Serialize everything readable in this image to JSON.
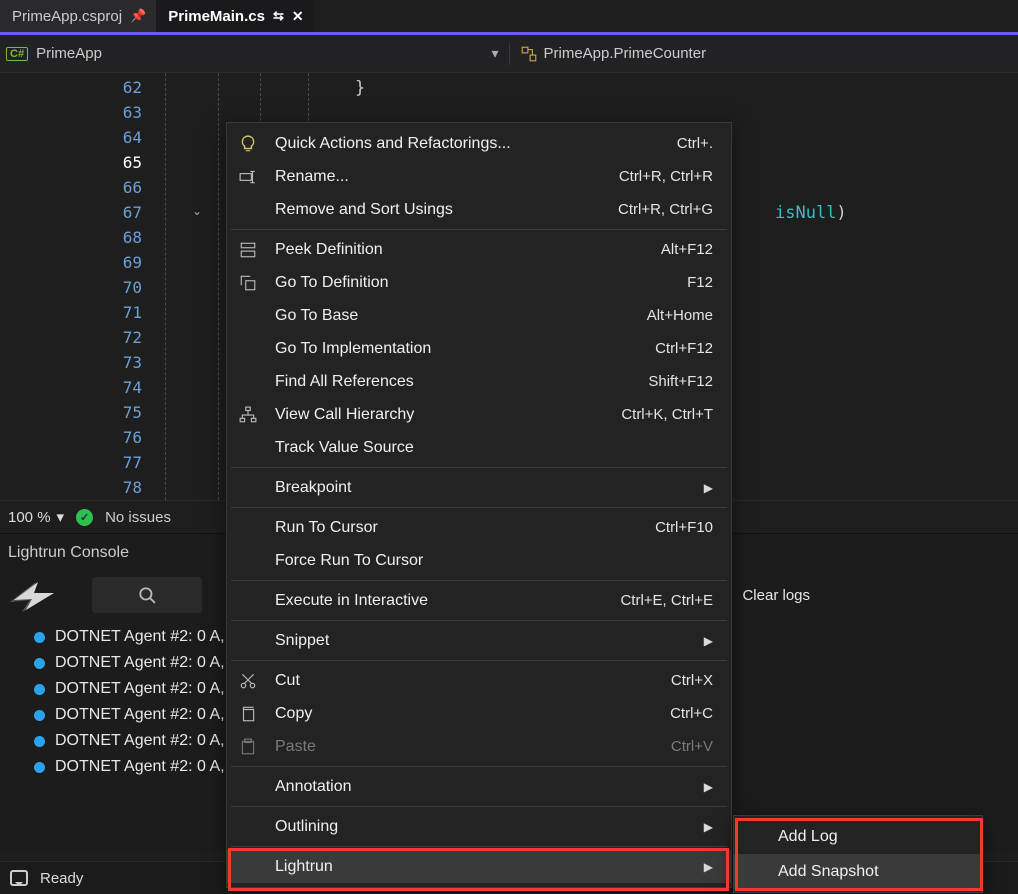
{
  "tabs": [
    {
      "filename": "PrimeApp.csproj",
      "active": false
    },
    {
      "filename": "PrimeMain.cs",
      "active": true
    }
  ],
  "navbar": {
    "left_text": "PrimeApp",
    "right_text": "PrimeApp.PrimeCounter"
  },
  "editor": {
    "line_numbers": [
      "62",
      "63",
      "64",
      "65",
      "66",
      "67",
      "68",
      "69",
      "70",
      "71",
      "72",
      "73",
      "74",
      "75",
      "76",
      "77",
      "78"
    ],
    "current_line": "65",
    "brace": "}",
    "visible_token": "isNull",
    "visible_token_paren": ")"
  },
  "editor_status": {
    "zoom": "100 %",
    "no_issues": "No issues"
  },
  "console": {
    "title": "Lightrun Console",
    "clear_label": "Clear logs",
    "rows": [
      "DOTNET Agent #2: 0",
      "DOTNET Agent #2: 0",
      "DOTNET Agent #2: 0",
      "DOTNET Agent #2: 0",
      "DOTNET Agent #2: 0",
      "DOTNET Agent #2: 0"
    ],
    "row_suffix_partial_first": "A, Invocation exception",
    "row_suffix_partial": "A, Invocation exception\""
  },
  "statusbar": {
    "ready": "Ready"
  },
  "context_menu": [
    {
      "type": "item",
      "icon": "bulb",
      "label": "Quick Actions and Refactorings...",
      "shortcut": "Ctrl+."
    },
    {
      "type": "item",
      "icon": "rename",
      "label": "Rename...",
      "shortcut": "Ctrl+R, Ctrl+R"
    },
    {
      "type": "item",
      "icon": "",
      "label": "Remove and Sort Usings",
      "shortcut": "Ctrl+R, Ctrl+G"
    },
    {
      "type": "sep"
    },
    {
      "type": "item",
      "icon": "peek",
      "label": "Peek Definition",
      "shortcut": "Alt+F12"
    },
    {
      "type": "item",
      "icon": "goto",
      "label": "Go To Definition",
      "shortcut": "F12"
    },
    {
      "type": "item",
      "icon": "",
      "label": "Go To Base",
      "shortcut": "Alt+Home"
    },
    {
      "type": "item",
      "icon": "",
      "label": "Go To Implementation",
      "shortcut": "Ctrl+F12"
    },
    {
      "type": "item",
      "icon": "",
      "label": "Find All References",
      "shortcut": "Shift+F12"
    },
    {
      "type": "item",
      "icon": "hier",
      "label": "View Call Hierarchy",
      "shortcut": "Ctrl+K, Ctrl+T"
    },
    {
      "type": "item",
      "icon": "",
      "label": "Track Value Source",
      "shortcut": ""
    },
    {
      "type": "sep"
    },
    {
      "type": "item",
      "icon": "",
      "label": "Breakpoint",
      "submenu": true
    },
    {
      "type": "sep"
    },
    {
      "type": "item",
      "icon": "",
      "label": "Run To Cursor",
      "shortcut": "Ctrl+F10"
    },
    {
      "type": "item",
      "icon": "",
      "label": "Force Run To Cursor",
      "shortcut": ""
    },
    {
      "type": "sep"
    },
    {
      "type": "item",
      "icon": "",
      "label": "Execute in Interactive",
      "shortcut": "Ctrl+E, Ctrl+E"
    },
    {
      "type": "sep"
    },
    {
      "type": "item",
      "icon": "",
      "label": "Snippet",
      "submenu": true
    },
    {
      "type": "sep"
    },
    {
      "type": "item",
      "icon": "cut",
      "label": "Cut",
      "shortcut": "Ctrl+X"
    },
    {
      "type": "item",
      "icon": "copy",
      "label": "Copy",
      "shortcut": "Ctrl+C"
    },
    {
      "type": "item",
      "icon": "paste",
      "label": "Paste",
      "shortcut": "Ctrl+V",
      "disabled": true
    },
    {
      "type": "sep"
    },
    {
      "type": "item",
      "icon": "",
      "label": "Annotation",
      "submenu": true
    },
    {
      "type": "sep"
    },
    {
      "type": "item",
      "icon": "",
      "label": "Outlining",
      "submenu": true
    },
    {
      "type": "sep"
    },
    {
      "type": "item",
      "icon": "",
      "label": "Lightrun",
      "submenu": true,
      "highlight": true
    }
  ],
  "submenu_lightrun": [
    {
      "label": "Add Log",
      "highlight": false
    },
    {
      "label": "Add Snapshot",
      "highlight": true
    }
  ]
}
